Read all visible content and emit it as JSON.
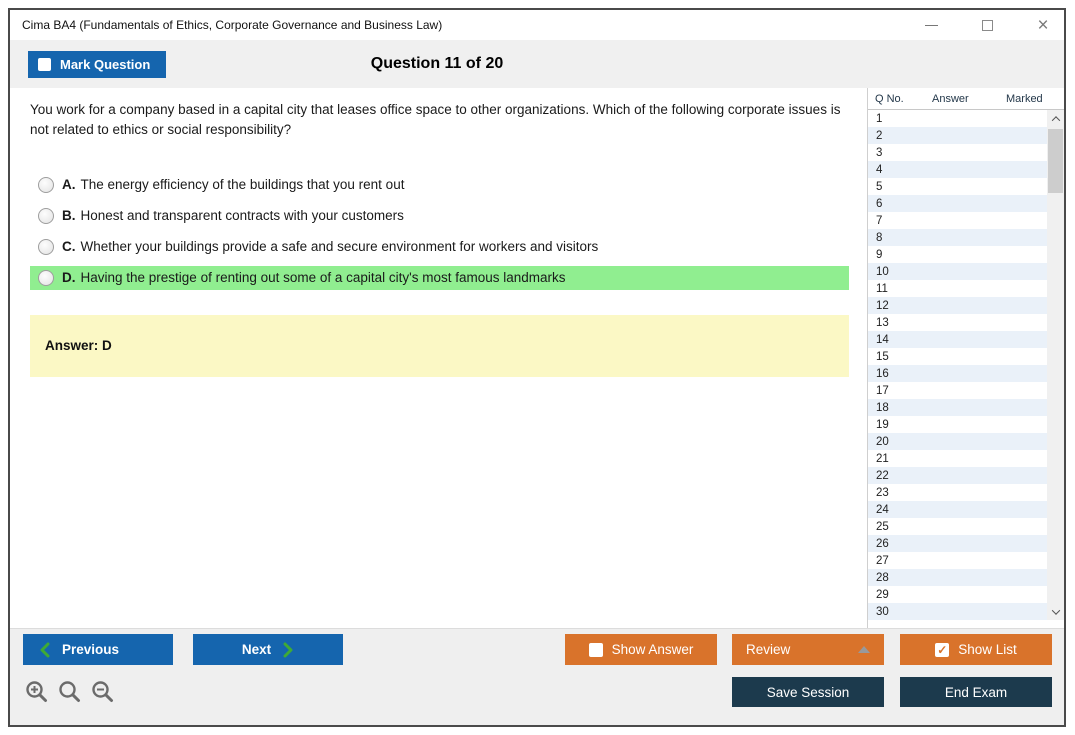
{
  "window": {
    "title": "Cima BA4 (Fundamentals of Ethics, Corporate Governance and Business Law)",
    "controls": {
      "close_glyph": "×"
    }
  },
  "header": {
    "mark_question_label": "Mark Question",
    "question_counter": "Question 11 of 20"
  },
  "question": {
    "text": "You work for a company based in a capital city that leases office space to other organizations. Which of the following corporate issues is not related to ethics or social responsibility?",
    "options": [
      {
        "letter": "A.",
        "text": "The energy efficiency of the buildings that you rent out"
      },
      {
        "letter": "B.",
        "text": "Honest and transparent contracts with your customers"
      },
      {
        "letter": "C.",
        "text": "Whether your buildings provide a safe and secure environment for workers and visitors"
      },
      {
        "letter": "D.",
        "text": "Having the prestige of renting out some of a capital city's most famous landmarks"
      }
    ],
    "answer_label": "Answer: D"
  },
  "sidebar": {
    "columns": [
      "Q No.",
      "Answer",
      "Marked"
    ],
    "rows": [
      "1",
      "2",
      "3",
      "4",
      "5",
      "6",
      "7",
      "8",
      "9",
      "10",
      "11",
      "12",
      "13",
      "14",
      "15",
      "16",
      "17",
      "18",
      "19",
      "20",
      "21",
      "22",
      "23",
      "24",
      "25",
      "26",
      "27",
      "28",
      "29",
      "30"
    ]
  },
  "footer": {
    "previous_label": "Previous",
    "next_label": "Next",
    "show_answer_label": "Show Answer",
    "review_label": "Review",
    "show_list_label": "Show List",
    "save_session_label": "Save Session",
    "end_exam_label": "End Exam",
    "show_list_checked_glyph": "✓"
  },
  "colors": {
    "blue": "#1565ae",
    "orange": "#d9732b",
    "navy": "#1c3a4d",
    "highlight_green": "#90ee90",
    "answer_yellow": "#fbf8c5",
    "chevron_green": "#3faa35",
    "alt_row_blue": "#eaf1f9"
  }
}
